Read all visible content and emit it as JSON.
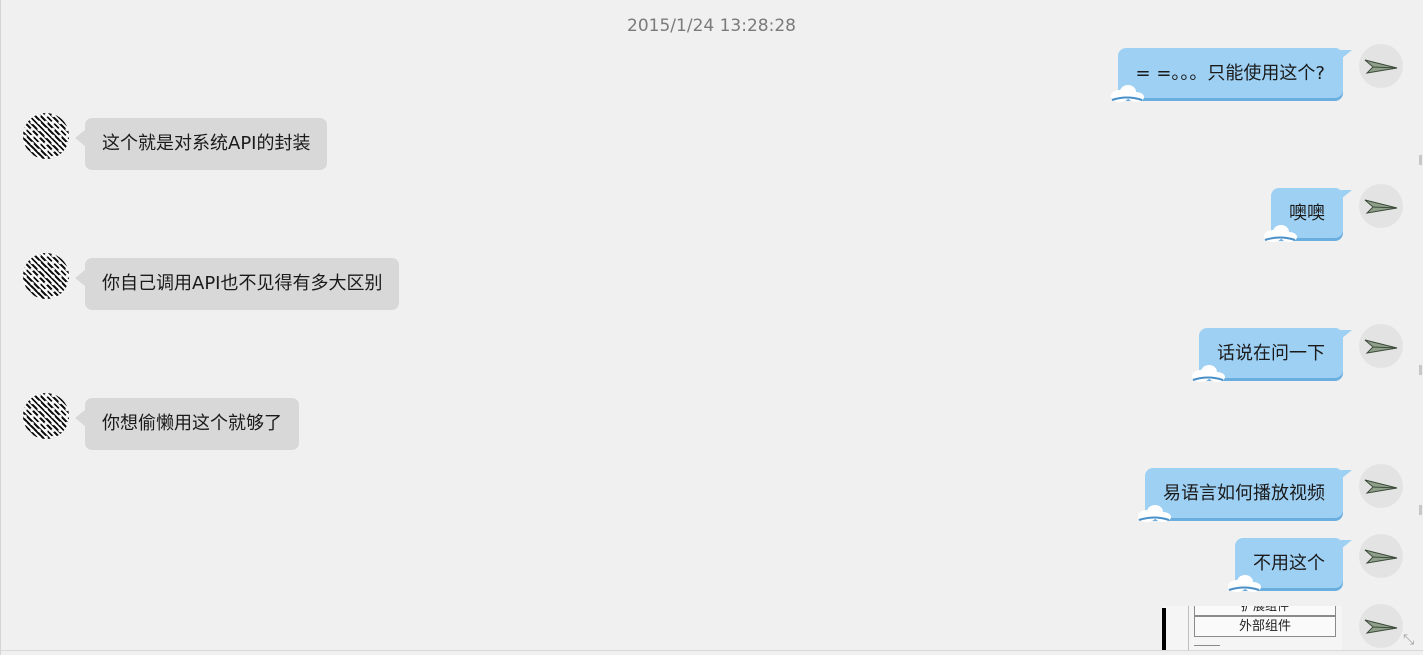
{
  "timestamp": "2015/1/24 13:28:28",
  "messages": [
    {
      "side": "right",
      "text": "= =。。。只能使用这个?"
    },
    {
      "side": "left",
      "text": "这个就是对系统API的封装"
    },
    {
      "side": "right",
      "text": "噢噢"
    },
    {
      "side": "left",
      "text": "你自己调用API也不见得有多大区别"
    },
    {
      "side": "right",
      "text": "话说在问一下"
    },
    {
      "side": "left",
      "text": "你想偷懒用这个就够了"
    },
    {
      "side": "right",
      "text": "易语言如何播放视频"
    },
    {
      "side": "right",
      "text": "不用这个"
    }
  ],
  "image_snippet": {
    "top_row": "扩展组件",
    "row_label": "外部组件"
  },
  "colors": {
    "background": "#f0f0f0",
    "bubble_left": "#d8d8d8",
    "bubble_right": "#9ed0f3",
    "bubble_right_shadow": "#6aaee0",
    "timestamp_text": "#7a7a7a"
  },
  "icons": {
    "left_avatar": "noise-pattern-avatar",
    "right_avatar": "paper-plane-icon",
    "bubble_decoration": "cloud-icon"
  }
}
